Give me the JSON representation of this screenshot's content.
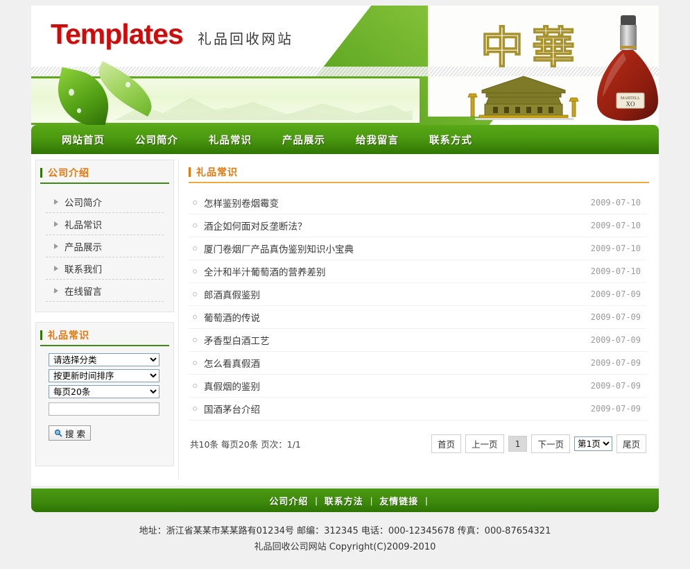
{
  "header": {
    "logo_main": "Templates",
    "logo_sub": "礼品回收网站",
    "banner_characters": "中華",
    "banner_bottle_label": "XO",
    "banner_bottle_brand": "MARTELL"
  },
  "nav": {
    "items": [
      {
        "label": "网站首页"
      },
      {
        "label": "公司简介"
      },
      {
        "label": "礼品常识"
      },
      {
        "label": "产品展示"
      },
      {
        "label": "给我留言"
      },
      {
        "label": "联系方式"
      }
    ]
  },
  "sidebar": {
    "company_panel": {
      "title": "公司介绍",
      "items": [
        {
          "label": "公司简介"
        },
        {
          "label": "礼品常识"
        },
        {
          "label": "产品展示"
        },
        {
          "label": "联系我们"
        },
        {
          "label": "在线留言"
        }
      ]
    },
    "search_panel": {
      "title": "礼品常识",
      "category_select": "请选择分类",
      "sort_select": "按更新时间排序",
      "perpage_select": "每页20条",
      "keyword_value": "",
      "keyword_placeholder": "",
      "search_button": "搜 索",
      "search_icon": "magnifier-icon"
    }
  },
  "main": {
    "title": "礼品常识",
    "articles": [
      {
        "title": "怎样鉴别卷烟霉变",
        "date": "2009-07-10"
      },
      {
        "title": "酒企如何面对反垄断法？",
        "date": "2009-07-10"
      },
      {
        "title": "厦门卷烟厂产品真伪鉴别知识小宝典",
        "date": "2009-07-10"
      },
      {
        "title": "全汁和半汁葡萄酒的营养差别",
        "date": "2009-07-10"
      },
      {
        "title": "郎酒真假鉴别",
        "date": "2009-07-09"
      },
      {
        "title": "葡萄酒的传说",
        "date": "2009-07-09"
      },
      {
        "title": "矛香型白酒工艺",
        "date": "2009-07-09"
      },
      {
        "title": "怎么看真假酒",
        "date": "2009-07-09"
      },
      {
        "title": "真假烟的鉴别",
        "date": "2009-07-09"
      },
      {
        "title": "国酒茅台介绍",
        "date": "2009-07-09"
      }
    ],
    "pager": {
      "info": "共10条 每页20条 页次：1/1",
      "first": "首页",
      "prev": "上一页",
      "current": "1",
      "next": "下一页",
      "jump": "第1页",
      "last": "尾页"
    }
  },
  "footer": {
    "links": [
      {
        "label": "公司介绍"
      },
      {
        "label": "联系方法"
      },
      {
        "label": "友情链接"
      }
    ],
    "separator": "|",
    "address_line": "地址：浙江省某某市某某路有01234号 邮编：312345 电话：000-12345678 传真：000-87654321",
    "copyright_line": "礼品回收公司网站  Copyright(C)2009-2010"
  },
  "colors": {
    "brand_red": "#cf0c0c",
    "nav_green": "#3d8a0c",
    "accent_orange": "#e8760a",
    "panel_bg": "#f6f6f6"
  }
}
